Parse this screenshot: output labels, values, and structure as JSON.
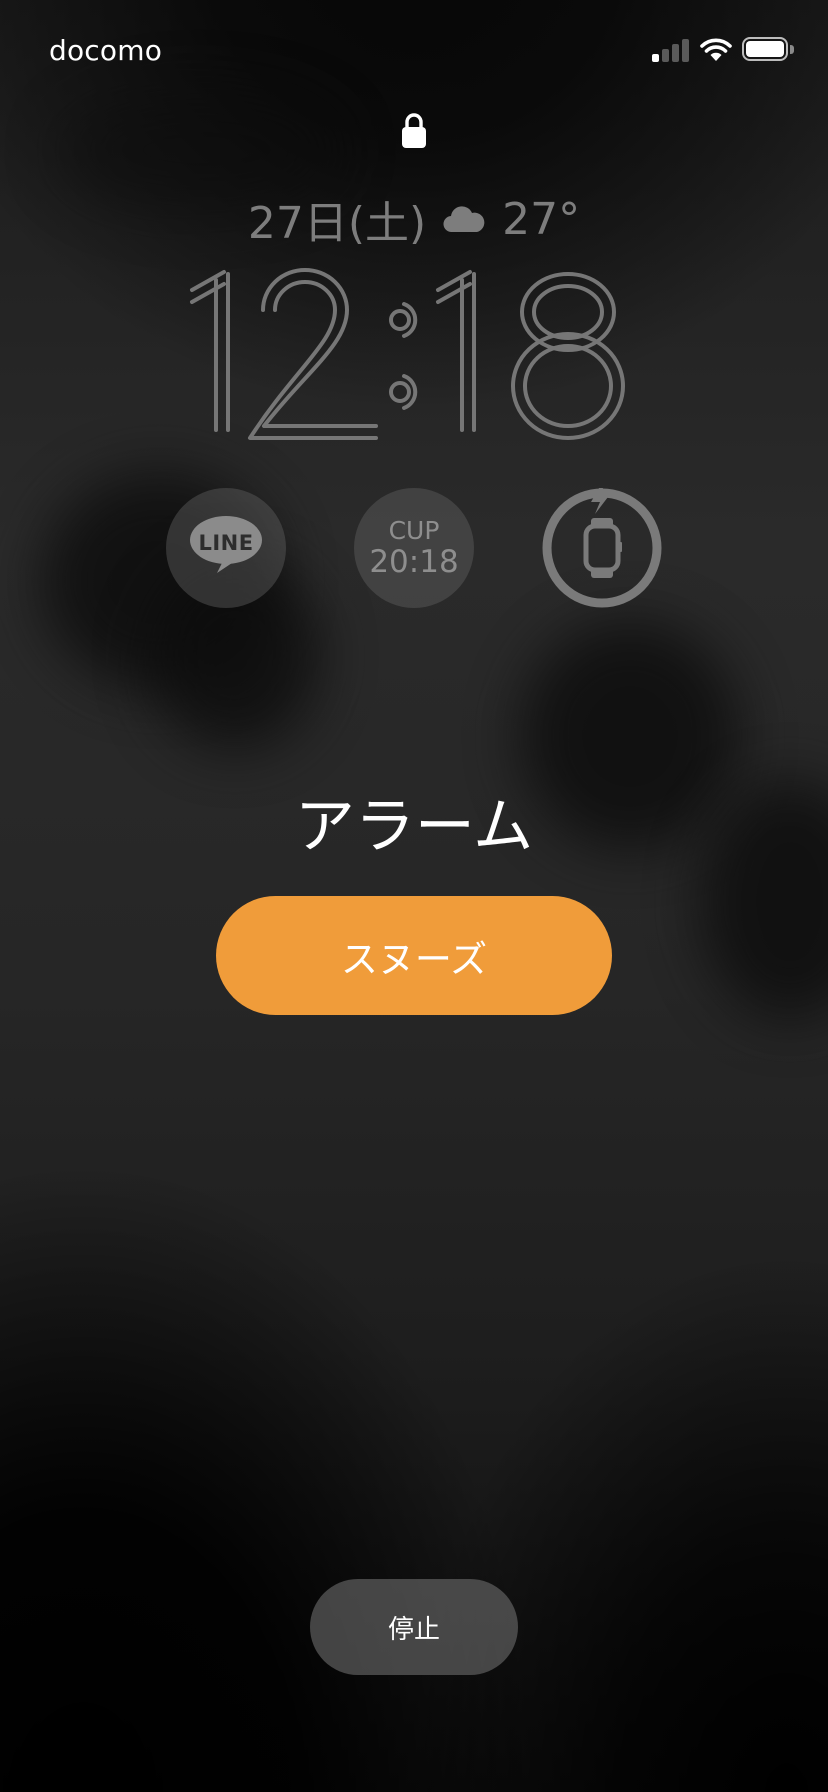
{
  "status_bar": {
    "carrier": "docomo",
    "signal_bars_filled": 1,
    "signal_bars_total": 4,
    "wifi_icon": "wifi-icon",
    "battery_icon": "battery-icon"
  },
  "lock_screen": {
    "lock_icon": "lock-icon",
    "date": "27日(土)",
    "weather_icon": "cloud-icon",
    "temperature": "27°",
    "time": "12:18"
  },
  "widgets": {
    "line": {
      "label": "LINE",
      "icon": "line-chat-icon"
    },
    "countdown": {
      "label": "CUP",
      "time": "20:18"
    },
    "watch_battery": {
      "icon": "apple-watch-charging-icon",
      "charge_icon": "lightning-icon"
    }
  },
  "alarm": {
    "title": "アラーム",
    "snooze_label": "スヌーズ",
    "stop_label": "停止"
  },
  "colors": {
    "snooze_button": "#f09c3a",
    "stop_button": "#5f5f5f",
    "widget_text": "#8e8e8e",
    "date_text": "#7d7d7d"
  }
}
